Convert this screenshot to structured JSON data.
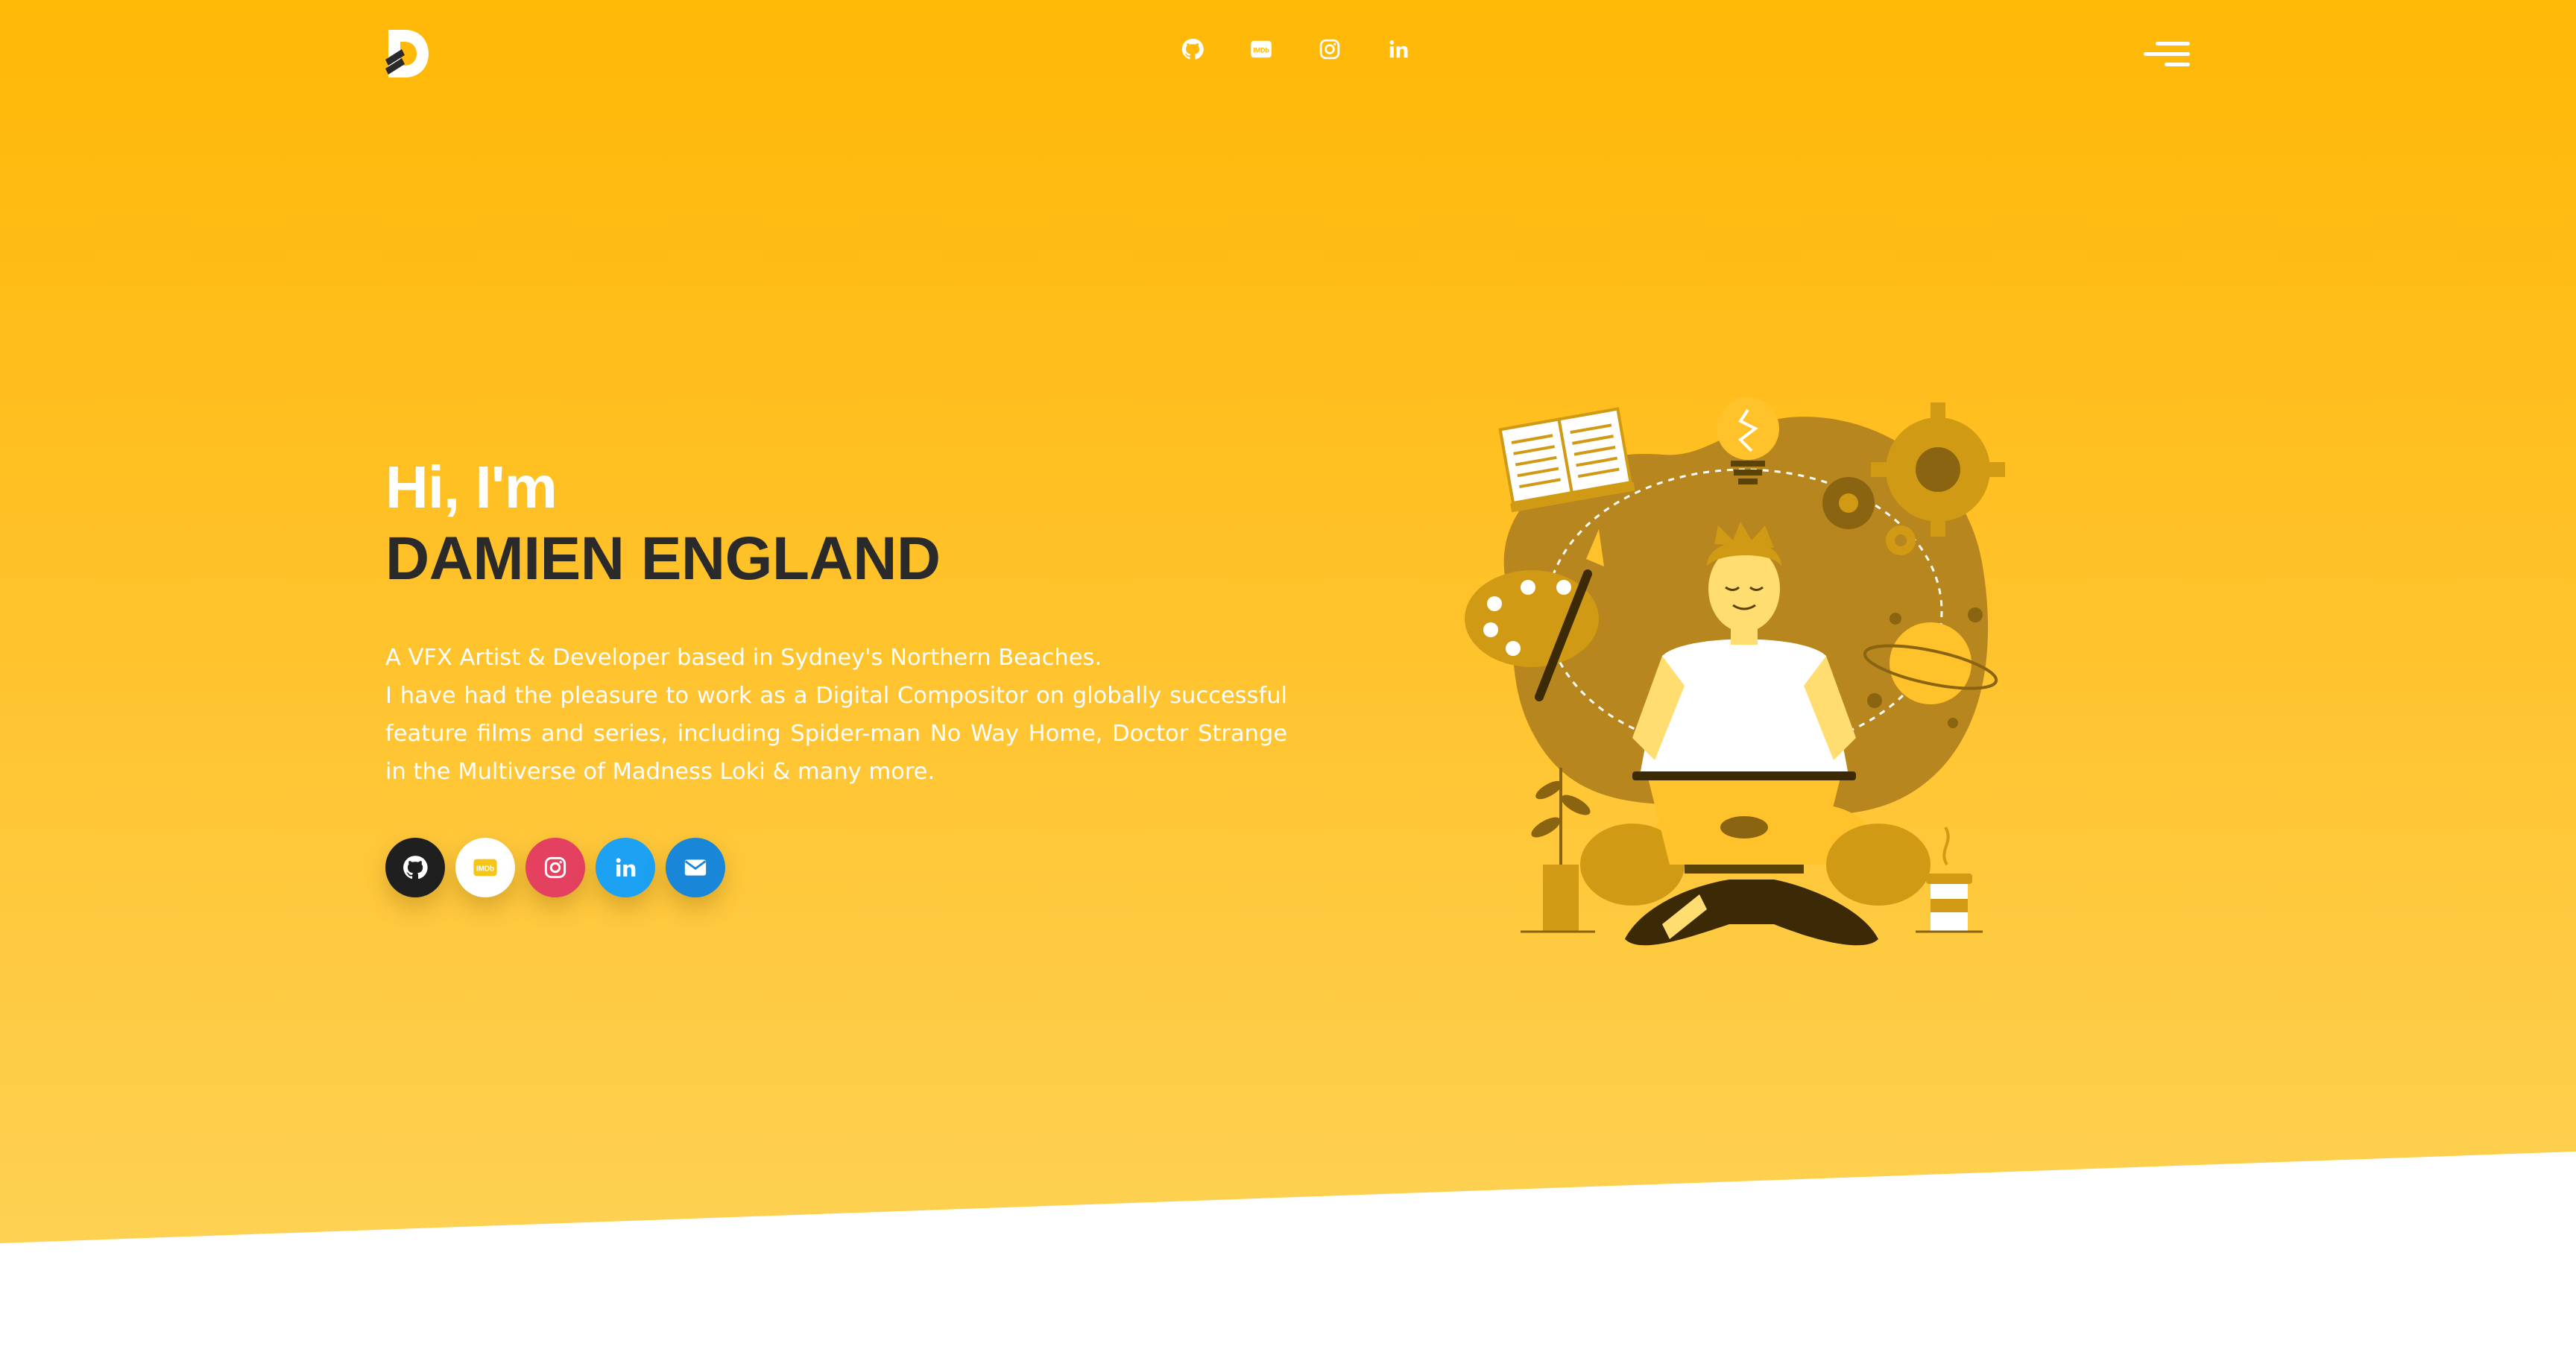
{
  "header": {
    "logo_icon": "d-logo-icon",
    "social": [
      {
        "name": "github-icon"
      },
      {
        "name": "imdb-icon"
      },
      {
        "name": "instagram-icon"
      },
      {
        "name": "linkedin-icon"
      }
    ],
    "menu_icon": "hamburger-menu-icon"
  },
  "intro": {
    "greeting": "Hi, I'm",
    "name": "DAMIEN ENGLAND",
    "bio_line1": "A VFX Artist & Developer based in Sydney's Northern Beaches.",
    "bio_line2": "I have had the pleasure to work as a Digital Compositor on globally successful feature films and series, including Spider-man No Way Home, Doctor Strange in the Multiverse of Madness Loki & many more."
  },
  "social_buttons": [
    {
      "name": "github-icon",
      "bg": "#1f1f1f",
      "fg": "#ffffff"
    },
    {
      "name": "imdb-icon",
      "bg": "#ffffff",
      "fg": "#f5c518"
    },
    {
      "name": "instagram-icon",
      "bg": "#e4405f",
      "fg": "#ffffff"
    },
    {
      "name": "linkedin-icon",
      "bg": "#1da1f2",
      "fg": "#ffffff"
    },
    {
      "name": "email-icon",
      "bg": "#1a86d8",
      "fg": "#ffffff"
    }
  ],
  "colors": {
    "hero_top": "#ffb806",
    "hero_bottom": "#fed45a",
    "name_text": "#2a2a2a",
    "illustration_blob": "#b8861f"
  }
}
